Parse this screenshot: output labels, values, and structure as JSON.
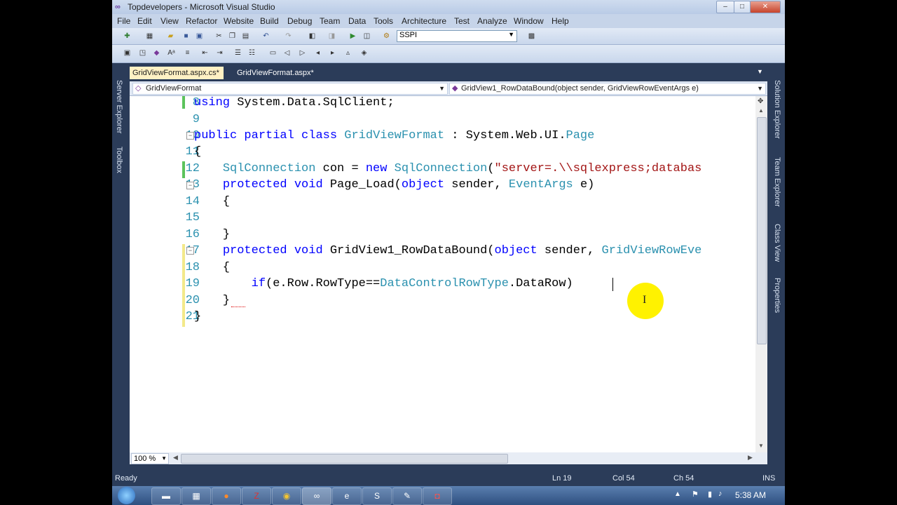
{
  "window": {
    "title": "Topdevelopers - Microsoft Visual Studio",
    "min": "–",
    "max": "□",
    "close": "✕"
  },
  "menu": [
    "File",
    "Edit",
    "View",
    "Refactor",
    "Website",
    "Build",
    "Debug",
    "Team",
    "Data",
    "Tools",
    "Architecture",
    "Test",
    "Analyze",
    "Window",
    "Help"
  ],
  "toolbar": {
    "config_value": "SSPI"
  },
  "side_left": {
    "server_explorer": "Server Explorer",
    "toolbox": "Toolbox"
  },
  "side_right": {
    "solution_explorer": "Solution Explorer",
    "team_explorer": "Team Explorer",
    "class_view": "Class View",
    "properties": "Properties"
  },
  "tabs": [
    {
      "label": "GridViewFormat.aspx.cs*",
      "active": true
    },
    {
      "label": "GridViewFormat.aspx*",
      "active": false
    }
  ],
  "nav": {
    "type_dropdown": "GridViewFormat",
    "member_dropdown": "GridView1_RowDataBound(object sender, GridViewRowEventArgs e)"
  },
  "code": {
    "line_numbers": [
      "8",
      "9",
      "10",
      "11",
      "12",
      "13",
      "14",
      "15",
      "16",
      "17",
      "18",
      "19",
      "20",
      "21"
    ]
  },
  "zoom": "100 %",
  "status": {
    "state": "Ready",
    "line": "Ln 19",
    "col": "Col 54",
    "ch": "Ch 54",
    "mode": "INS"
  },
  "taskbar": {
    "time": "5:38 AM"
  },
  "colors": {
    "keyword": "#0000ff",
    "type": "#2b91af",
    "string": "#a31515",
    "chrome": "#2b3c59"
  }
}
